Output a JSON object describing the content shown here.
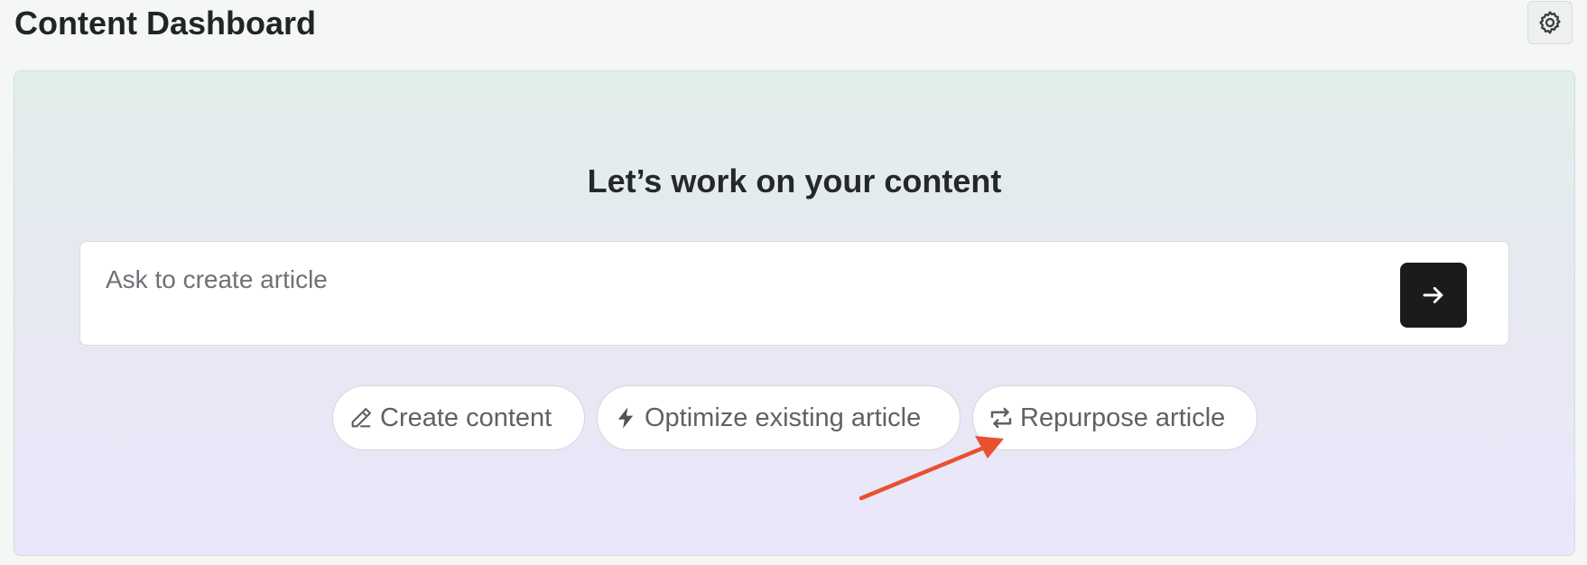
{
  "header": {
    "title": "Content Dashboard",
    "settings_icon": "gear-icon"
  },
  "hero": {
    "headline": "Let’s work on your content",
    "prompt": {
      "placeholder": "Ask to create article",
      "value": "",
      "send_icon": "arrow-right-icon"
    },
    "actions": [
      {
        "label": "Create content",
        "icon": "pencil-icon"
      },
      {
        "label": "Optimize existing article",
        "icon": "lightning-icon"
      },
      {
        "label": "Repurpose article",
        "icon": "repeat-icon"
      }
    ]
  },
  "annotation": {
    "type": "arrow",
    "color": "#e8502f",
    "points_to": "Repurpose article"
  },
  "colors": {
    "send_button": "#1a1c1b",
    "panel_top": "#e1eeeb",
    "panel_bottom": "#ebe6fb",
    "annotation_arrow": "#e8502f"
  }
}
